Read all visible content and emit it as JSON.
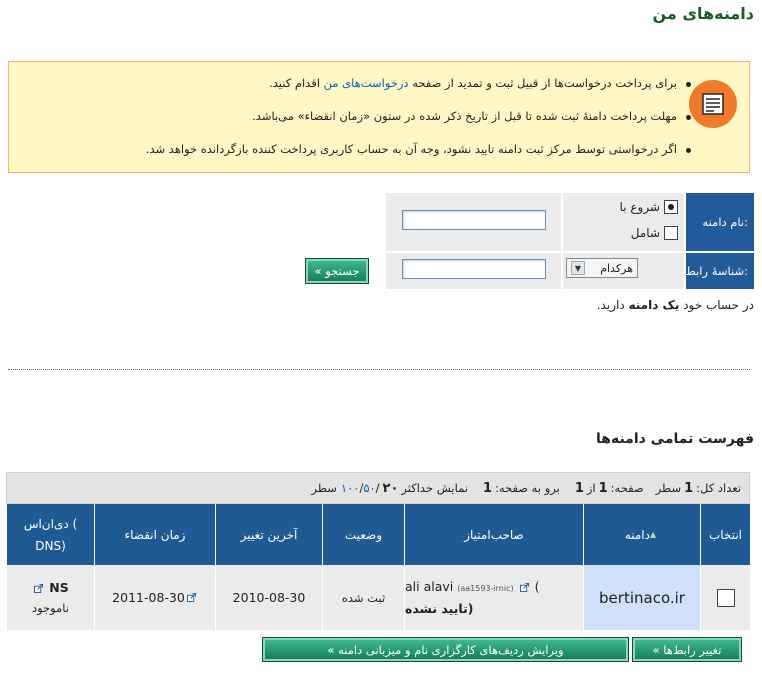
{
  "page_title": "دامنه‌های من",
  "notice": {
    "line1_before": "برای پرداخت درخواست‌ها از قبیل ثبت و تمدید از صفحه",
    "line1_link": "درخواست‌های من",
    "line1_after": "اقدام کنید.",
    "line2": "مهلت پرداخت دامنهٔ ثبت شده تا قبل از تاریخ ذکر شده در ستون «زمان انقضاء» می‌باشد.",
    "line3": "اگر درخواستی توسط مرکز ثبت دامنه تایید نشود، وجه آن به حساب کاربری پرداخت کننده بازگردانده خواهد شد."
  },
  "search": {
    "domain_label": "نام دامنه:",
    "radio_starts": "شروع با",
    "radio_contains": "شامل",
    "handle_label": "شناسهٔ رابط:",
    "select_value": "هرکدام",
    "search_button": "جستجو »"
  },
  "count": {
    "before": "در حساب خود",
    "bold": "یک دامنه",
    "after": "دارید."
  },
  "list_title": "فهرست تمامی دامنه‌ها",
  "pager": {
    "total_label": "تعداد کل:",
    "total_value": "1",
    "total_unit": "سطر",
    "page_label": "صفحه:",
    "page_value": "1",
    "of_label": "از",
    "of_value": "1",
    "goto_label": "برو به صفحه:",
    "goto_value": "1",
    "max_label": "نمایش حداکثر",
    "opt_20": "۲۰",
    "opt_50": "۵۰",
    "opt_100": "۱۰۰",
    "rows_label": "سطر",
    "sep": "/"
  },
  "table": {
    "headers": {
      "select": "انتخاب",
      "domain": "دامنه",
      "holder": "صاحب‌امتیاز",
      "status": "وضعیت",
      "last_change": "آخرین تغییر",
      "expiry": "زمان انقضاء",
      "dns_line1": "دی‌ان‌اس (",
      "dns_line2": "DNS)"
    },
    "row": {
      "domain": "bertinaco.ir",
      "holder_name": "ali alavi",
      "holder_id": "(aa1593-irnic)",
      "holder_paren": ")",
      "holder_status": "(تایید نشده",
      "status": "ثبت شده",
      "last_change": "2010-08-30",
      "expiry": "2011-08-30",
      "dns_ns": "NS",
      "dns_status": "ناموجود"
    }
  },
  "buttons": {
    "change_contacts": "تغییر رابط‌ها »",
    "edit_ns": "ویرایش ردیف‌های کارگزاری نام و میزبانی دامنه »"
  },
  "colors": {
    "title_green": "#1d5a2b",
    "header_blue": "#1f5a95",
    "notice_bg": "#fff8c4",
    "notice_icon": "#f07a2a",
    "domain_cell": "#cfe0fb",
    "button_green": "#15795a"
  }
}
